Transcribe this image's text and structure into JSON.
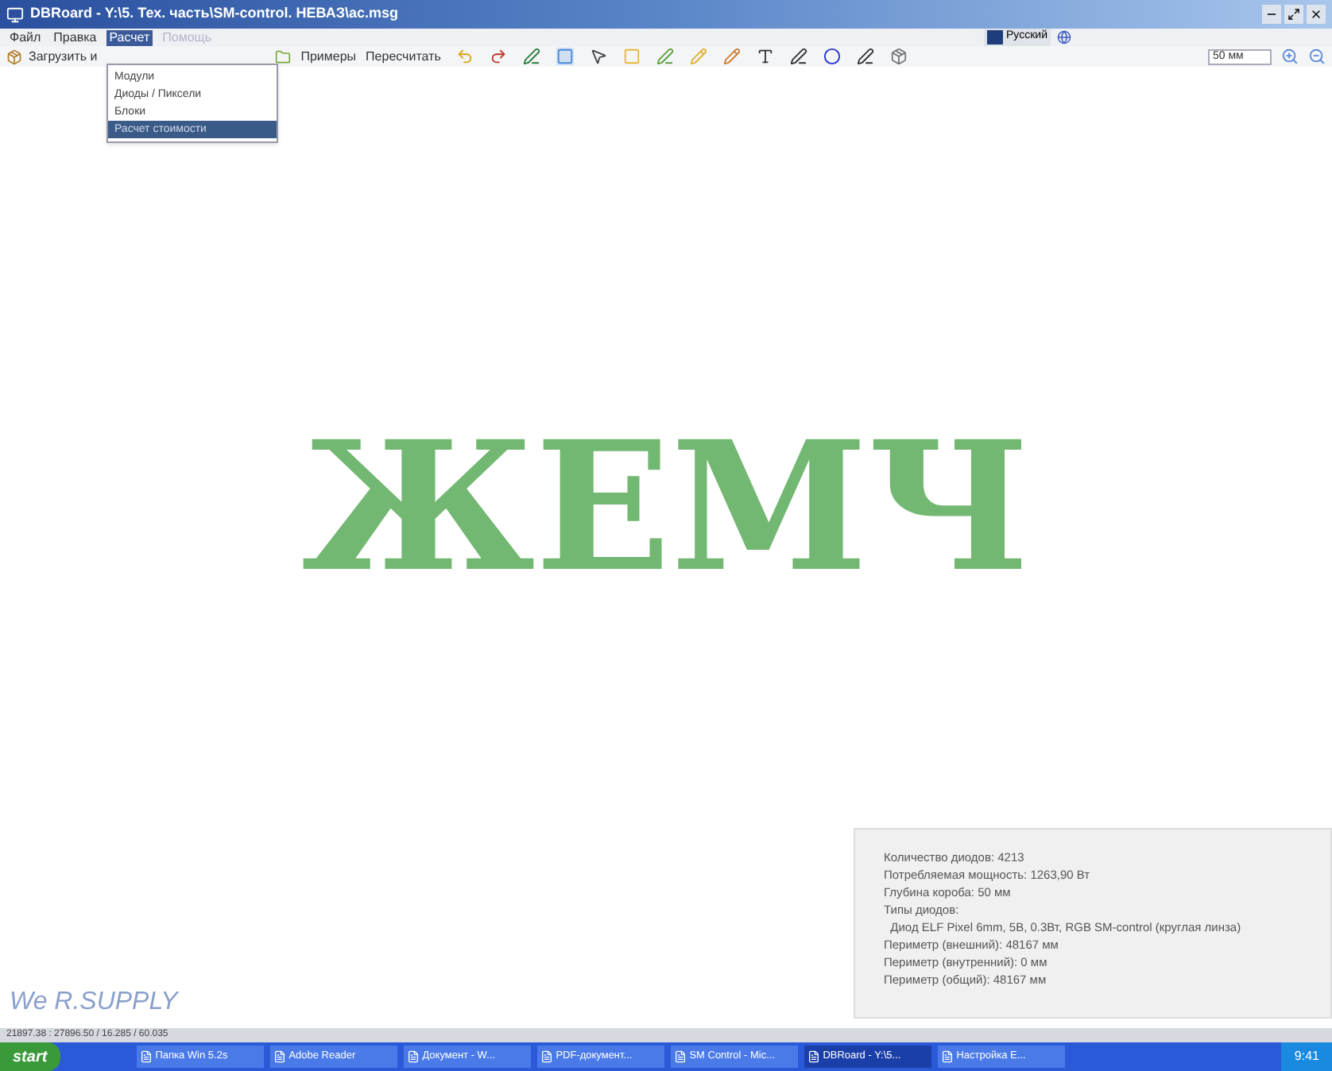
{
  "window": {
    "title": "DBRoard - Y:\\5. Тех. часть\\SM-control. НЕВАЗ\\ас.msg"
  },
  "menu": [
    {
      "label": "Файл",
      "selected": false,
      "disabled": false
    },
    {
      "label": "Правка",
      "selected": false,
      "disabled": false
    },
    {
      "label": "Расчет",
      "selected": true,
      "disabled": false
    },
    {
      "label": "Помощь",
      "selected": false,
      "disabled": true
    }
  ],
  "dropdown": [
    {
      "label": "Модули",
      "selected": false
    },
    {
      "label": "Диоды / Пиксели",
      "selected": false
    },
    {
      "label": "Блоки",
      "selected": false
    },
    {
      "label": "Расчет стоимости",
      "selected": true
    }
  ],
  "toolbar": {
    "load": "Загрузить и",
    "examples": "Примеры",
    "recalc": "Пересчитать",
    "size": "50 мм",
    "language": "Русский"
  },
  "canvas": {
    "text": "ЖЕМЧ"
  },
  "info": [
    "Количество диодов: 4213",
    "Потребляемая мощность: 1263,90 Вт",
    "Глубина короба: 50 мм",
    "Типы диодов:",
    "  Диод ELF Pixel 6mm, 5В, 0.3Вт, RGB SM-control (круглая линза)",
    "Периметр (внешний): 48167 мм",
    "Периметр (внутренний): 0 мм",
    "Периметр (общий): 48167 мм"
  ],
  "logo": "We R.SUPPLY",
  "status_bar": "21897.38 : 27896.50 / 16.285 / 60.035",
  "taskbar": {
    "start": "start",
    "items": [
      {
        "label": "Папка Win 5.2s",
        "selected": false
      },
      {
        "label": "Adobe Reader",
        "selected": false
      },
      {
        "label": "Документ - W...",
        "selected": false
      },
      {
        "label": "PDF-документ...",
        "selected": false
      },
      {
        "label": "SM Control - Mic...",
        "selected": false
      },
      {
        "label": "DBRoard - Y:\\5...",
        "selected": true
      },
      {
        "label": "Настройка Е...",
        "selected": false
      }
    ],
    "clock": "9:41"
  }
}
